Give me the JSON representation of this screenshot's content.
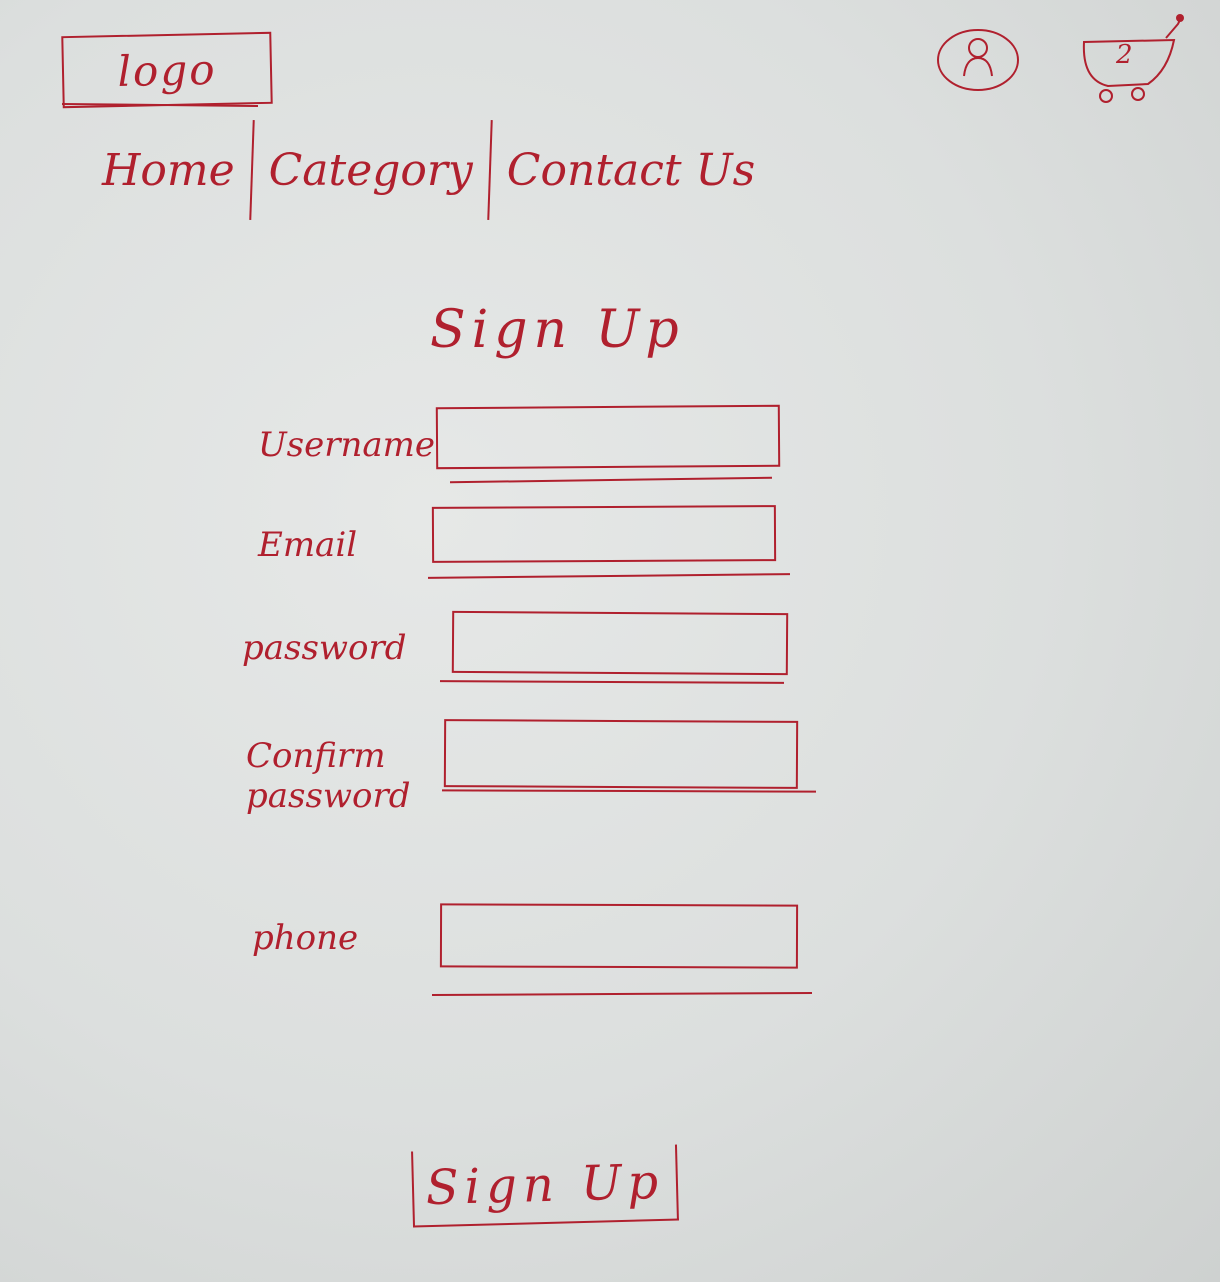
{
  "header": {
    "logo_text": "logo",
    "user_icon": "user-icon",
    "cart_icon": "cart-icon",
    "cart_count": "2"
  },
  "nav": {
    "items": [
      {
        "label": "Home"
      },
      {
        "label": "Category"
      },
      {
        "label": "Contact Us"
      }
    ]
  },
  "form": {
    "title": "Sign Up",
    "fields": [
      {
        "label": "Username",
        "value": ""
      },
      {
        "label": "Email",
        "value": ""
      },
      {
        "label": "password",
        "value": ""
      },
      {
        "label": "Confirm password",
        "value": ""
      },
      {
        "label": "phone",
        "value": ""
      }
    ],
    "submit_label": "Sign Up"
  },
  "colors": {
    "ink": "#b0202e",
    "paper": "#dfe1e0"
  }
}
